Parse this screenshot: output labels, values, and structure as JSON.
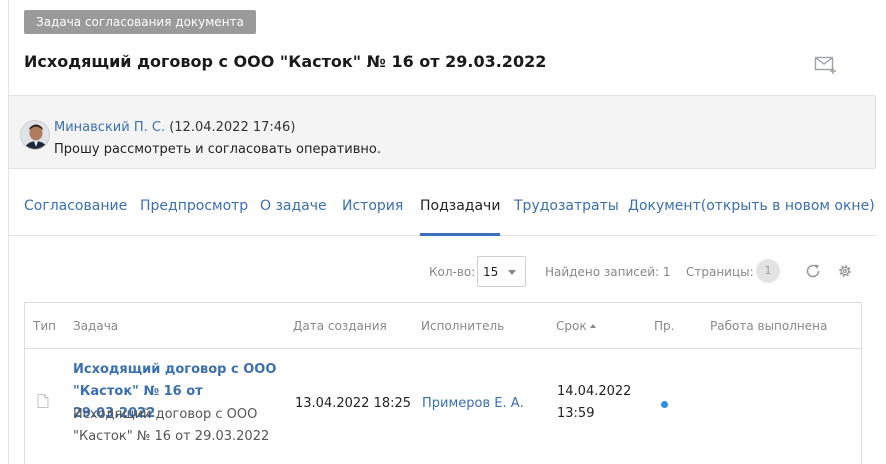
{
  "header": {
    "badge": "Задача согласования документа",
    "title": "Исходящий договор с ООО \"Касток\" № 16 от 29.03.2022"
  },
  "comment": {
    "author": "Минавский П. С.",
    "date": "(12.04.2022 17:46)",
    "text": "Прошу рассмотреть и согласовать оперативно."
  },
  "tabs": [
    {
      "label": "Согласование"
    },
    {
      "label": "Предпросмотр"
    },
    {
      "label": "О задаче"
    },
    {
      "label": "История"
    },
    {
      "label": "Подзадачи",
      "active": true
    },
    {
      "label": "Трудозатраты"
    },
    {
      "label": "Документ(открыть в новом окне)"
    }
  ],
  "toolbar": {
    "count_label": "Кол-во:",
    "count_value": "15",
    "found_label": "Найдено записей: 1",
    "pages_label": "Страницы:",
    "page_current": "1"
  },
  "grid": {
    "columns": [
      "Тип",
      "Задача",
      "Дата создания",
      "Исполнитель",
      "Срок",
      "Пр.",
      "Работа выполнена"
    ],
    "rows": [
      {
        "task_title": "Исходящий договор с ООО \"Касток\" № 16 от 29.03.2022",
        "task_description": "Исходящий договор с ООО \"Касток\" № 16 от 29.03.2022",
        "created": "13.04.2022 18:25",
        "executor": "Примеров Е. А.",
        "due_date": "14.04.2022",
        "due_time": "13:59",
        "priority": "normal",
        "done": ""
      }
    ]
  },
  "colors": {
    "link": "#3a6fb0",
    "active_tab_underline": "#3b6fc0",
    "priority_dot": "#2e8fe8",
    "badge_bg": "#9a9a9a"
  },
  "icons": [
    "envelope-plus-icon",
    "user-avatar",
    "refresh-icon",
    "gear-icon",
    "file-icon",
    "sort-asc-icon",
    "chevron-down-icon"
  ]
}
